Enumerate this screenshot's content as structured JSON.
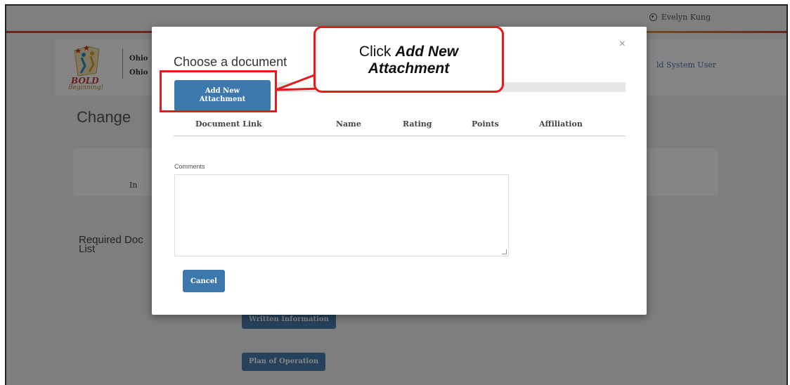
{
  "app": {
    "user_name": "Evelyn Kung",
    "logo_text_1": "BOLD",
    "logo_text_2": "Beginning!",
    "header_ohio_1": "Ohio",
    "header_ohio_2": "Ohio",
    "system_user": "ld System User",
    "page_title": "Change",
    "info_text": "In",
    "required_docs": "Required Doc",
    "required_docs_2": "List",
    "btn_written": "Written Information",
    "btn_plan": "Plan of Operation"
  },
  "modal": {
    "title": "Choose a document",
    "close": "×",
    "add_button": "Add New Attachment",
    "columns": [
      "Document Link",
      "Name",
      "Rating",
      "Points",
      "Affiliation"
    ],
    "comments_label": "Comments",
    "comments_value": "",
    "cancel_button": "Cancel"
  },
  "callout": {
    "prefix": "Click",
    "emphasis_1": "Add New",
    "emphasis_2": "Attachment"
  },
  "colors": {
    "accent_blue": "#3d78ad",
    "highlight_red": "#e51a1a"
  }
}
